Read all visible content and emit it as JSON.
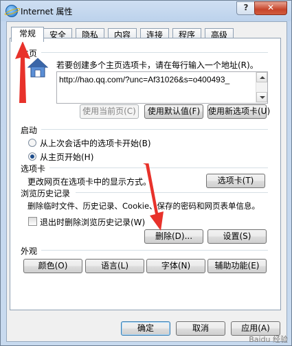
{
  "window": {
    "title": "Internet 属性",
    "help": "?",
    "close": "✕"
  },
  "tabs": [
    "常规",
    "安全",
    "隐私",
    "内容",
    "连接",
    "程序",
    "高级"
  ],
  "home": {
    "group_label": "主页",
    "instruction": "若要创建多个主页选项卡，请在每行输入一个地址(R)。",
    "url": "http://hao.qq.com/?unc=Af31026&s=o400493_",
    "btn_current": "使用当前页(C)",
    "btn_default": "使用默认值(F)",
    "btn_newtab": "使用新选项卡(U)"
  },
  "startup": {
    "group_label": "启动",
    "option1": "从上次会话中的选项卡开始(B)",
    "option2": "从主页开始(H)",
    "selected": "option2"
  },
  "tabsgroup": {
    "group_label": "选项卡",
    "desc": "更改网页在选项卡中的显示方式。",
    "button": "选项卡(T)"
  },
  "history": {
    "group_label": "浏览历史记录",
    "desc": "删除临时文件、历史记录、Cookie、保存的密码和网页表单信息。",
    "checkbox": "退出时删除浏览历史记录(W)",
    "btn_delete": "删除(D)...",
    "btn_settings": "设置(S)"
  },
  "appearance": {
    "group_label": "外观",
    "btn_colors": "颜色(O)",
    "btn_languages": "语言(L)",
    "btn_fonts": "字体(N)",
    "btn_accessibility": "辅助功能(E)"
  },
  "footer": {
    "ok": "确定",
    "cancel": "取消",
    "apply": "应用(A)",
    "watermark": "Baidu 经验"
  },
  "colors": {
    "annotation_arrow": "#e8322b"
  }
}
